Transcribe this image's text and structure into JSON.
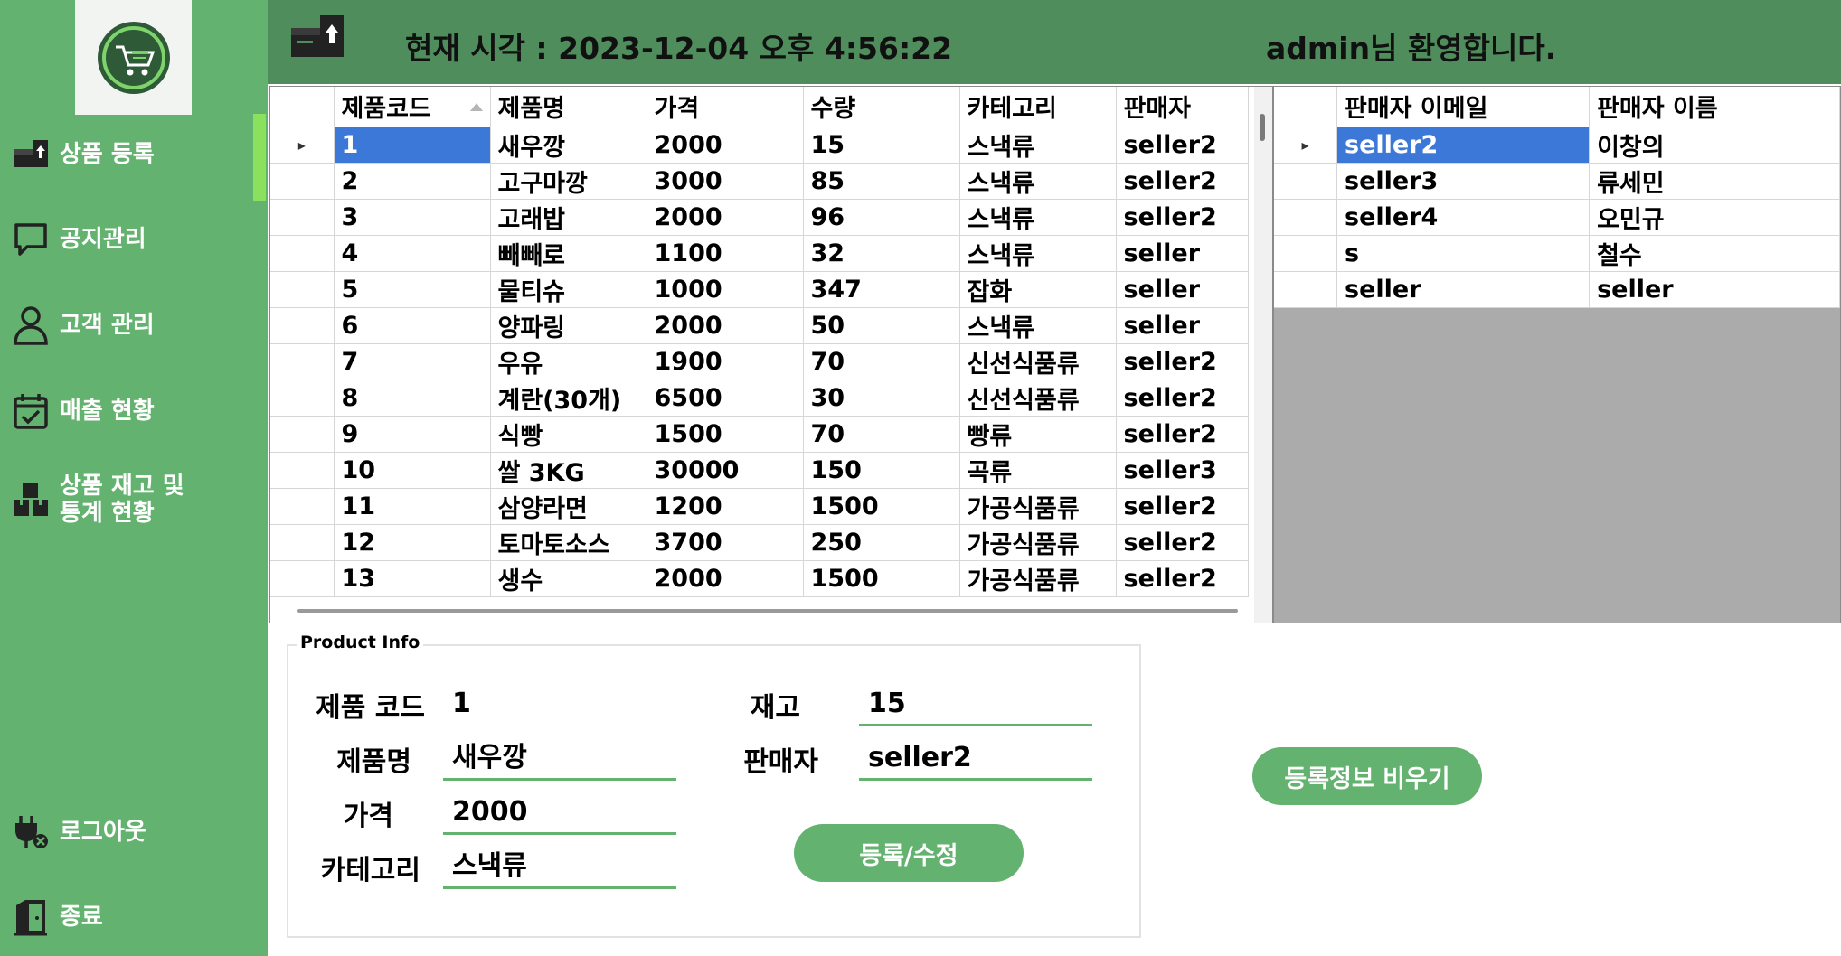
{
  "sidebar": {
    "logo_icon": "shopping-cart-logo-icon",
    "items": [
      {
        "label": "상품 등록",
        "icon": "box-upload-icon"
      },
      {
        "label": "공지관리",
        "icon": "chat-bubble-icon"
      },
      {
        "label": "고객 관리",
        "icon": "user-icon"
      },
      {
        "label": "매출 현황",
        "icon": "calendar-check-icon"
      },
      {
        "label": "상품 재고 및\n통계 현황",
        "icon": "boxes-icon"
      },
      {
        "label": "로그아웃",
        "icon": "plug-off-icon"
      },
      {
        "label": "종료",
        "icon": "door-exit-icon"
      }
    ]
  },
  "header": {
    "icon": "box-upload-icon",
    "clock": "현재 시각 : 2023-12-04 오후 4:56:22",
    "welcome": "admin님 환영합니다."
  },
  "products": {
    "columns": [
      "제품코드",
      "제품명",
      "가격",
      "수량",
      "카테고리",
      "판매자"
    ],
    "rows": [
      [
        "1",
        "새우깡",
        "2000",
        "15",
        "스낵류",
        "seller2"
      ],
      [
        "2",
        "고구마깡",
        "3000",
        "85",
        "스낵류",
        "seller2"
      ],
      [
        "3",
        "고래밥",
        "2000",
        "96",
        "스낵류",
        "seller2"
      ],
      [
        "4",
        "빼빼로",
        "1100",
        "32",
        "스낵류",
        "seller"
      ],
      [
        "5",
        "물티슈",
        "1000",
        "347",
        "잡화",
        "seller"
      ],
      [
        "6",
        "양파링",
        "2000",
        "50",
        "스낵류",
        "seller"
      ],
      [
        "7",
        "우유",
        "1900",
        "70",
        "신선식품류",
        "seller2"
      ],
      [
        "8",
        "계란(30개)",
        "6500",
        "30",
        "신선식품류",
        "seller2"
      ],
      [
        "9",
        "식빵",
        "1500",
        "70",
        "빵류",
        "seller2"
      ],
      [
        "10",
        "쌀 3KG",
        "30000",
        "150",
        "곡류",
        "seller3"
      ],
      [
        "11",
        "삼양라면",
        "1200",
        "1500",
        "가공식품류",
        "seller2"
      ],
      [
        "12",
        "토마토소스",
        "3700",
        "250",
        "가공식품류",
        "seller2"
      ],
      [
        "13",
        "생수",
        "2000",
        "1500",
        "가공식품류",
        "seller2"
      ]
    ]
  },
  "sellers": {
    "columns": [
      "판매자 이메일",
      "판매자 이름"
    ],
    "rows": [
      [
        "seller2",
        "이창의"
      ],
      [
        "seller3",
        "류세민"
      ],
      [
        "seller4",
        "오민규"
      ],
      [
        "s",
        "철수"
      ],
      [
        "seller",
        "seller"
      ]
    ]
  },
  "product_info": {
    "legend": "Product Info",
    "code_label": "제품 코드",
    "code_value": "1",
    "name_label": "제품명",
    "name_value": "새우깡",
    "price_label": "가격",
    "price_value": "2000",
    "category_label": "카테고리",
    "category_value": "스낵류",
    "stock_label": "재고",
    "stock_value": "15",
    "seller_label": "판매자",
    "seller_value": "seller2",
    "submit_label": "등록/수정",
    "clear_label": "등록정보 비우기"
  },
  "colors": {
    "sidebar": "#64b26f",
    "header": "#4f8e5c",
    "selection": "#3b78d8",
    "active_indicator": "#8be05d"
  }
}
